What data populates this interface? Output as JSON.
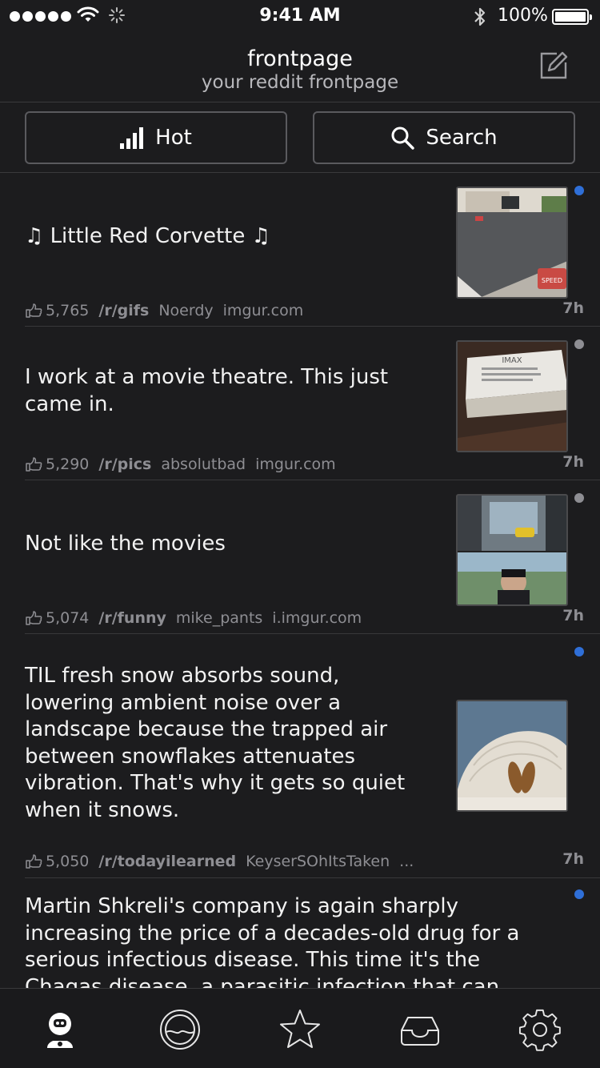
{
  "status_bar": {
    "time": "9:41 AM",
    "battery": "100%"
  },
  "header": {
    "title": "frontpage",
    "subtitle": "your reddit frontpage"
  },
  "toolbar": {
    "sort_label": "Hot",
    "search_label": "Search"
  },
  "posts": [
    {
      "title": "♫ Little Red Corvette ♫",
      "score": "5,765",
      "subreddit": "/r/gifs",
      "author": "Noerdy",
      "domain": "imgur.com",
      "age": "7h",
      "unread_dot": "#2f6fd8",
      "thumb": "street-gif-thumbnail"
    },
    {
      "title": "I work at a movie theatre. This just came in.",
      "score": "5,290",
      "subreddit": "/r/pics",
      "author": "absolutbad",
      "domain": "imgur.com",
      "age": "7h",
      "unread_dot": "#8e8e93",
      "thumb": "imax-box-thumbnail"
    },
    {
      "title": "Not like the movies",
      "score": "5,074",
      "subreddit": "/r/funny",
      "author": "mike_pants",
      "domain": "i.imgur.com",
      "age": "7h",
      "unread_dot": "#8e8e93",
      "thumb": "movie-stills-thumbnail"
    },
    {
      "title": "TIL fresh snow absorbs sound, lowering ambient noise over a landscape because the trapped air between snowflakes attenuates vibration. That's why it gets so quiet when it snows.",
      "score": "5,050",
      "subreddit": "/r/todayilearned",
      "author": "KeyserSOhItsTaken",
      "domain": "...",
      "age": "7h",
      "unread_dot": "#2f6fd8",
      "thumb": "igloo-thumbnail"
    },
    {
      "title": "Martin Shkreli's company is again sharply increasing the price of a decades-old drug for a serious infectious disease. This time it's the Chagas disease, a parasitic infection that can",
      "unread_dot": "#2f6fd8"
    }
  ],
  "tabbar": {
    "tabs": [
      "frontpage-tab-icon",
      "subreddits-tab-icon",
      "favorites-tab-icon",
      "inbox-tab-icon",
      "settings-tab-icon"
    ],
    "active_color": "#ffffff"
  }
}
